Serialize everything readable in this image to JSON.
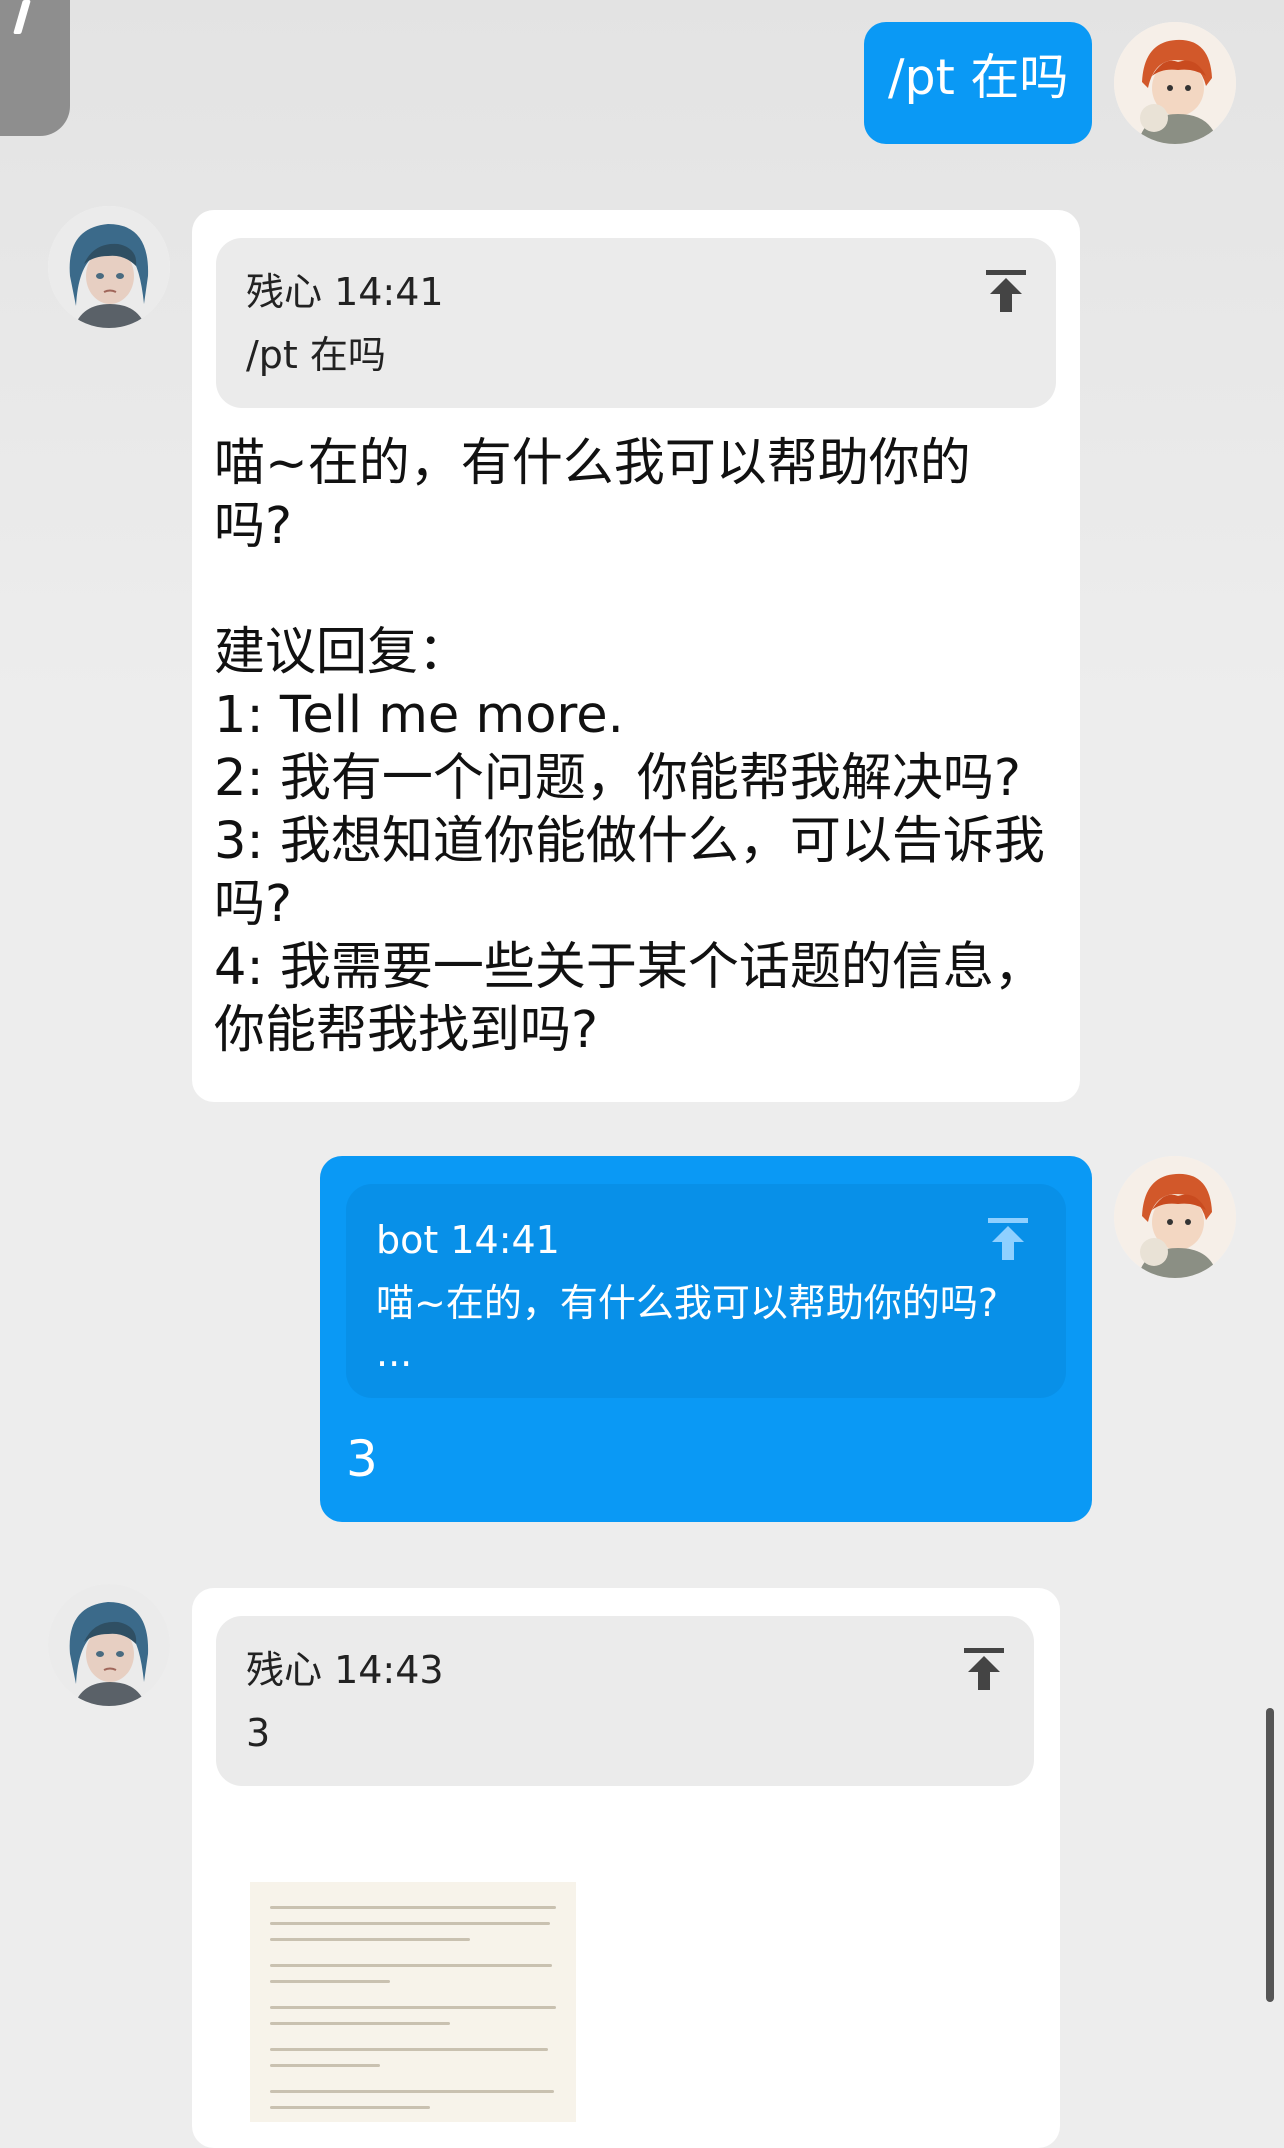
{
  "colors": {
    "background": "#ededed",
    "outgoing_bubble": "#0a99f5",
    "incoming_bubble": "#ffffff",
    "quote_gray": "#ebebeb"
  },
  "icons": {
    "pin": "pin-to-top-icon",
    "avatar_user": "user-avatar-icon",
    "avatar_bot": "bot-avatar-icon"
  },
  "messages": [
    {
      "id": "m1",
      "sender": "user",
      "text": "/pt 在吗"
    },
    {
      "id": "m2",
      "sender": "bot",
      "quote": {
        "header": "残心 14:41",
        "body": "/pt 在吗"
      },
      "text": "喵~在的，有什么我可以帮助你的\n吗?\n\n建议回复：\n1: Tell me more.\n2: 我有一个问题，你能帮我解决吗?\n3: 我想知道你能做什么，可以告诉我\n吗?\n4: 我需要一些关于某个话题的信息，\n你能帮我找到吗?"
    },
    {
      "id": "m3",
      "sender": "user",
      "quote": {
        "header": "bot 14:41",
        "body": "喵~在的，有什么我可以帮助你的吗?\n..."
      },
      "text": "3"
    },
    {
      "id": "m4",
      "sender": "bot",
      "quote": {
        "header": "残心 14:43",
        "body": "3"
      },
      "text": ""
    }
  ]
}
